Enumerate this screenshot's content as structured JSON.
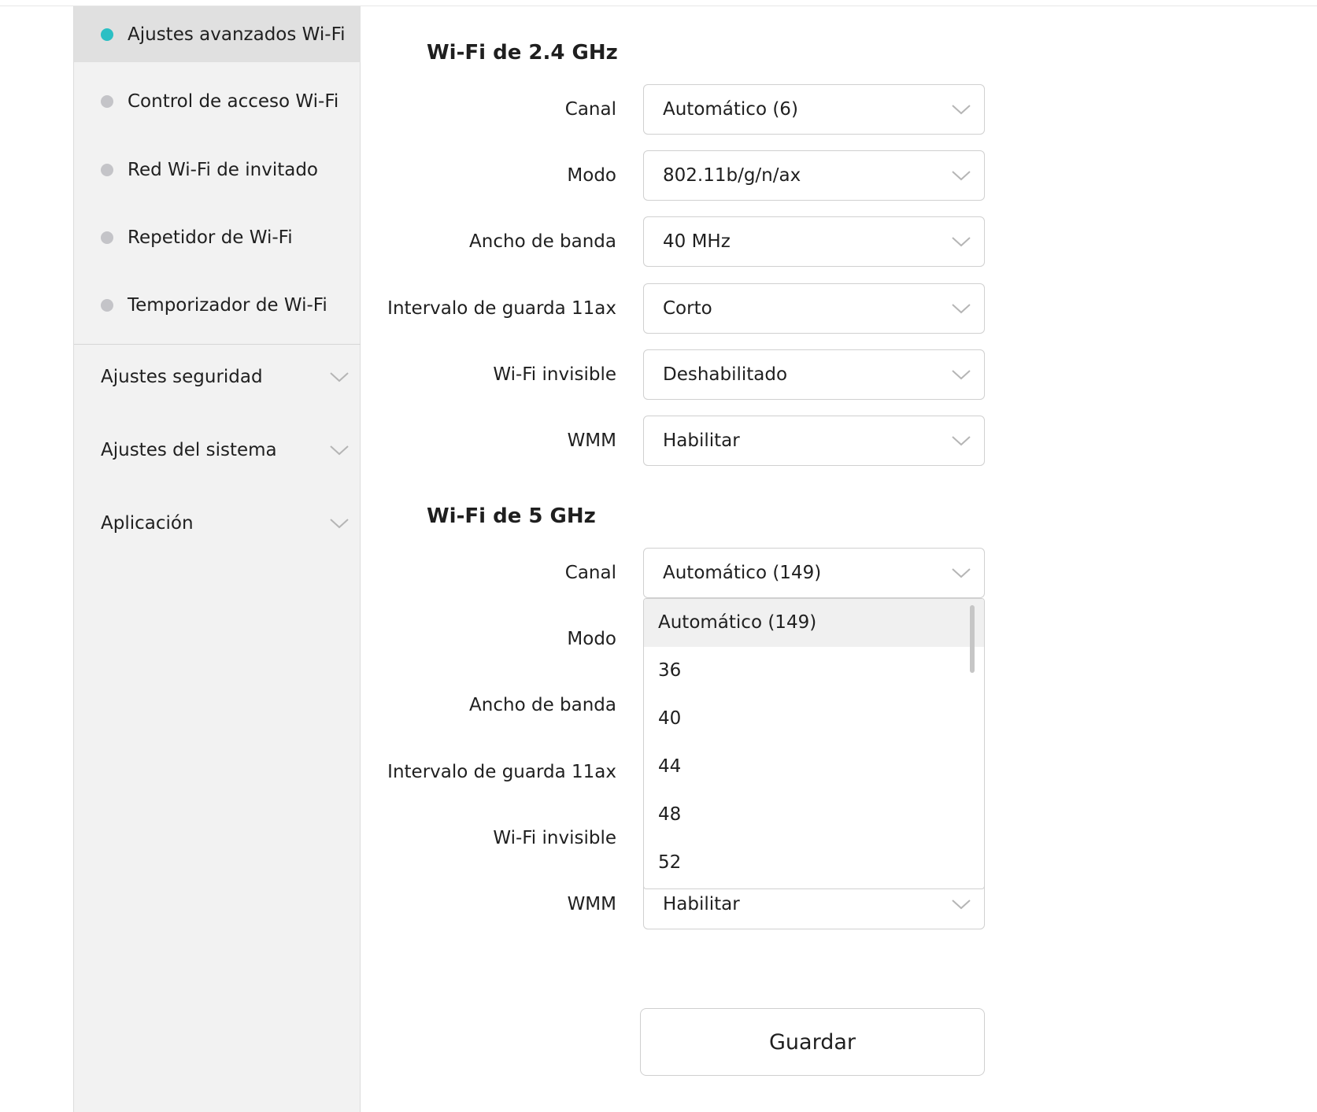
{
  "sidebar": {
    "sub_items": [
      {
        "label": "Ajustes avanzados Wi-Fi",
        "active": true
      },
      {
        "label": "Control de acceso Wi-Fi",
        "active": false
      },
      {
        "label": "Red Wi-Fi de invitado",
        "active": false
      },
      {
        "label": "Repetidor de Wi-Fi",
        "active": false
      },
      {
        "label": "Temporizador de Wi-Fi",
        "active": false
      }
    ],
    "groups": [
      {
        "label": "Ajustes seguridad"
      },
      {
        "label": "Ajustes del sistema"
      },
      {
        "label": "Aplicación"
      }
    ]
  },
  "band24": {
    "title": "Wi-Fi de 2.4 GHz",
    "fields": [
      {
        "label": "Canal",
        "value": "Automático (6)"
      },
      {
        "label": "Modo",
        "value": "802.11b/g/n/ax"
      },
      {
        "label": "Ancho de banda",
        "value": "40 MHz"
      },
      {
        "label": "Intervalo de guarda 11ax",
        "value": "Corto"
      },
      {
        "label": "Wi-Fi invisible",
        "value": "Deshabilitado"
      },
      {
        "label": "WMM",
        "value": "Habilitar"
      }
    ]
  },
  "band5": {
    "title": "Wi-Fi de 5 GHz",
    "fields": [
      {
        "label": "Canal",
        "value": "Automático (149)"
      },
      {
        "label": "Modo"
      },
      {
        "label": "Ancho de banda"
      },
      {
        "label": "Intervalo de guarda 11ax"
      },
      {
        "label": "Wi-Fi invisible"
      },
      {
        "label": "WMM",
        "value": "Habilitar"
      }
    ],
    "channel_options": [
      "Automático (149)",
      "36",
      "40",
      "44",
      "48",
      "52"
    ]
  },
  "actions": {
    "save_label": "Guardar"
  },
  "colors": {
    "active_dot": "#2bbfc4",
    "inactive_dot": "#c4c4c8"
  }
}
